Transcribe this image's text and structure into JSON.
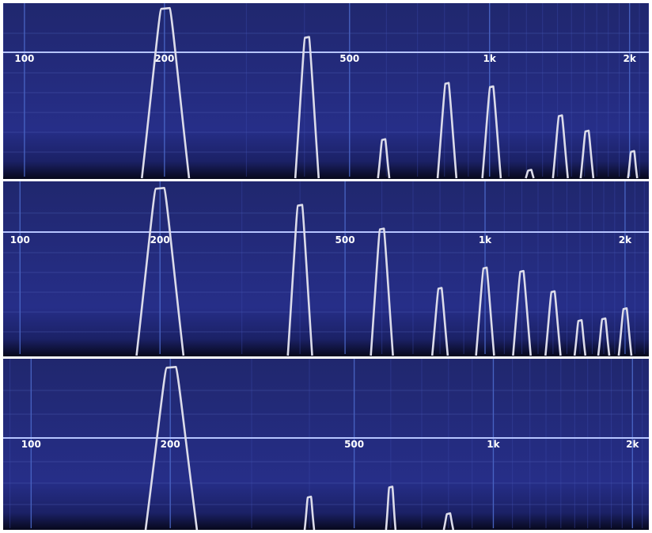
{
  "chart_data": [
    {
      "type": "spectrum",
      "x_scale": "log",
      "xlim": [
        90,
        2200
      ],
      "ylim": [
        0,
        1
      ],
      "x_tick_labels": [
        {
          "value": 100,
          "label": "100"
        },
        {
          "value": 200,
          "label": "200"
        },
        {
          "value": 500,
          "label": "500"
        },
        {
          "value": 1000,
          "label": "1k"
        },
        {
          "value": 2000,
          "label": "2k"
        }
      ],
      "peaks": [
        {
          "freq": 201,
          "level": 0.99
        },
        {
          "freq": 405,
          "level": 0.82
        },
        {
          "freq": 592,
          "level": 0.22
        },
        {
          "freq": 810,
          "level": 0.55
        },
        {
          "freq": 1010,
          "level": 0.53
        },
        {
          "freq": 1220,
          "level": 0.04
        },
        {
          "freq": 1420,
          "level": 0.36
        },
        {
          "freq": 1620,
          "level": 0.27
        },
        {
          "freq": 2030,
          "level": 0.15
        }
      ]
    },
    {
      "type": "spectrum",
      "x_scale": "log",
      "xlim": [
        92,
        2250
      ],
      "ylim": [
        0,
        1
      ],
      "x_tick_labels": [
        {
          "value": 100,
          "label": "100"
        },
        {
          "value": 200,
          "label": "200"
        },
        {
          "value": 500,
          "label": "500"
        },
        {
          "value": 1000,
          "label": "1k"
        },
        {
          "value": 2000,
          "label": "2k"
        }
      ],
      "peaks": [
        {
          "freq": 200,
          "level": 0.98
        },
        {
          "freq": 400,
          "level": 0.88
        },
        {
          "freq": 600,
          "level": 0.74
        },
        {
          "freq": 800,
          "level": 0.39
        },
        {
          "freq": 1000,
          "level": 0.51
        },
        {
          "freq": 1200,
          "level": 0.49
        },
        {
          "freq": 1400,
          "level": 0.37
        },
        {
          "freq": 1600,
          "level": 0.2
        },
        {
          "freq": 1800,
          "level": 0.21
        },
        {
          "freq": 2000,
          "level": 0.27
        }
      ]
    },
    {
      "type": "spectrum",
      "x_scale": "log",
      "xlim": [
        87,
        2170
      ],
      "ylim": [
        0,
        1
      ],
      "x_tick_labels": [
        {
          "value": 100,
          "label": "100"
        },
        {
          "value": 200,
          "label": "200"
        },
        {
          "value": 500,
          "label": "500"
        },
        {
          "value": 1000,
          "label": "1k"
        },
        {
          "value": 2000,
          "label": "2k"
        }
      ],
      "peaks": [
        {
          "freq": 201,
          "level": 0.97
        },
        {
          "freq": 400,
          "level": 0.19
        },
        {
          "freq": 600,
          "level": 0.25
        },
        {
          "freq": 800,
          "level": 0.09
        }
      ]
    }
  ]
}
